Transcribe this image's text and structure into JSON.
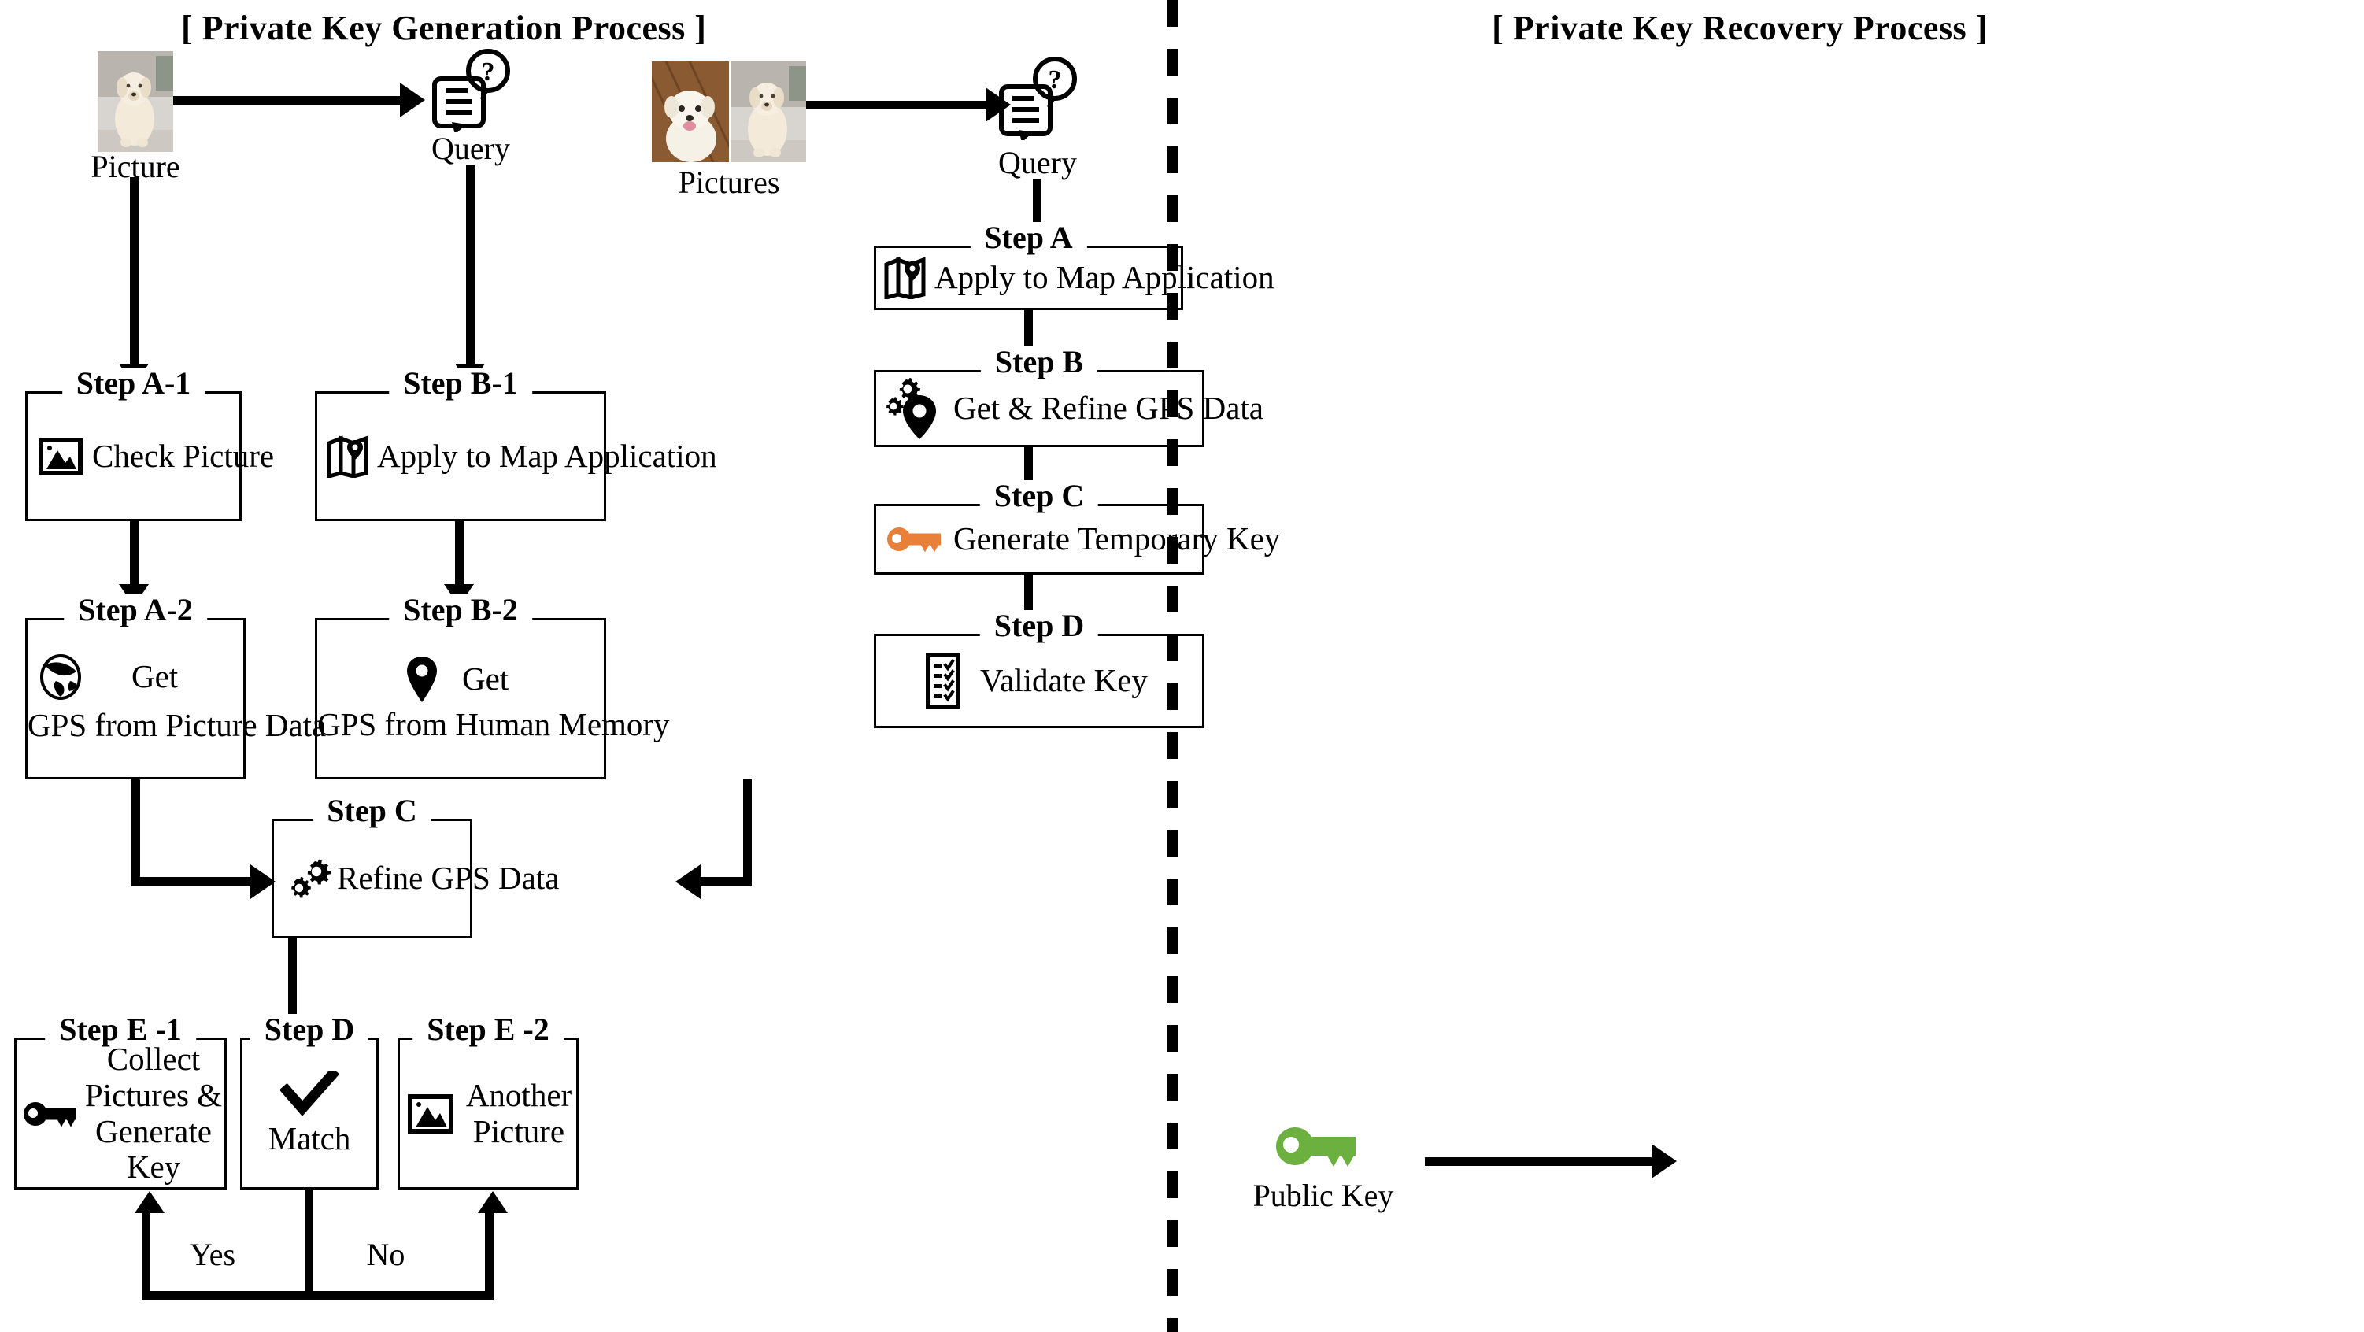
{
  "left_panel": {
    "title": "[ Private Key Generation Process ]",
    "input_label": "Picture",
    "query_label": "Query",
    "steps": [
      {
        "id": "A-1",
        "legend": "Step A-1",
        "text": "Check Picture",
        "icon": "image-icon"
      },
      {
        "id": "A-2",
        "legend": "Step A-2",
        "line1": "Get",
        "line2": "GPS from Picture Data",
        "icon": "globe-icon"
      },
      {
        "id": "B-1",
        "legend": "Step B-1",
        "text": "Apply to Map Application",
        "icon": "map-pin-icon"
      },
      {
        "id": "B-2",
        "legend": "Step B-2",
        "line1": "Get",
        "line2": "GPS from Human Memory",
        "icon": "location-pin-icon"
      },
      {
        "id": "C",
        "legend": "Step C",
        "text": "Refine GPS Data",
        "icon": "gears-icon"
      },
      {
        "id": "E-1",
        "legend": "Step E -1",
        "line1": "Collect Pictures &",
        "line2": "Generate Key",
        "icon": "key-icon"
      },
      {
        "id": "D",
        "legend": "Step D",
        "text": "Match",
        "icon": "checkmark-icon"
      },
      {
        "id": "E-2",
        "legend": "Step E -2",
        "line1": "Another",
        "line2": "Picture",
        "icon": "image-icon"
      }
    ],
    "branch_yes": "Yes",
    "branch_no": "No"
  },
  "right_panel": {
    "title": "[ Private Key Recovery Process ]",
    "input_label": "Pictures",
    "query_label": "Query",
    "public_key_label": "Public Key",
    "steps": [
      {
        "id": "A",
        "legend": "Step A",
        "text": "Apply to Map Application",
        "icon": "map-pin-icon"
      },
      {
        "id": "B",
        "legend": "Step B",
        "text": "Get & Refine GPS Data",
        "icon": "gears-pin-icon"
      },
      {
        "id": "C",
        "legend": "Step C",
        "text": "Generate Temporary Key",
        "icon": "key-icon-orange"
      },
      {
        "id": "D",
        "legend": "Step D",
        "text": "Validate Key",
        "icon": "checklist-icon"
      }
    ]
  },
  "colors": {
    "stroke": "#000000",
    "background": "#ffffff",
    "key_orange": "#E8803A",
    "key_green": "#6CB040"
  }
}
